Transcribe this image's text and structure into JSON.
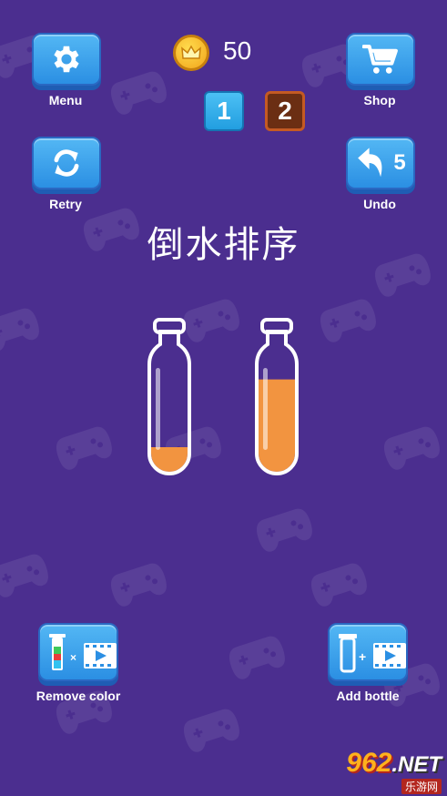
{
  "colors": {
    "background": "#4b2e8f",
    "button": "#3aa3ee",
    "liquid": "#f29440",
    "level_current": "#229ee0",
    "level_next": "#6b2e13"
  },
  "header": {
    "coin_count": "50",
    "coin_icon": "crown-coin-icon",
    "levels": [
      "1",
      "2"
    ]
  },
  "buttons": {
    "menu_label": "Menu",
    "shop_label": "Shop",
    "retry_label": "Retry",
    "undo_label": "Undo",
    "undo_count": "5",
    "remove_color_label": "Remove color",
    "add_bottle_label": "Add bottle"
  },
  "title": "倒水排序",
  "bottles": [
    {
      "fill_fraction": 0.25,
      "color": "#f29440"
    },
    {
      "fill_fraction": 0.85,
      "color": "#f29440"
    }
  ],
  "watermark": {
    "main": "962",
    "suffix": ".NET",
    "sub": "乐游网"
  }
}
